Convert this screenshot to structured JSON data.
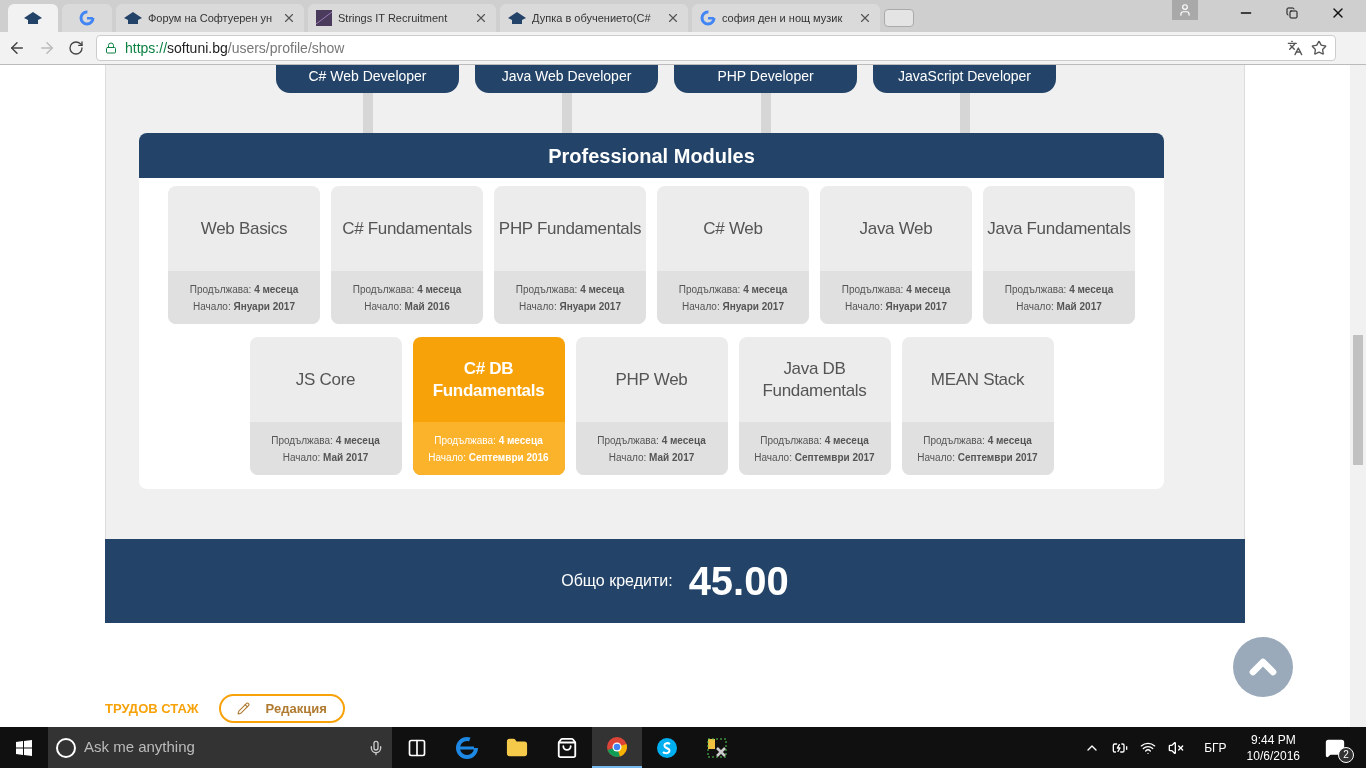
{
  "browser": {
    "tabs": [
      {
        "kind": "hat",
        "pinned": true,
        "selected": true
      },
      {
        "kind": "google",
        "pinned": true,
        "selected": false
      },
      {
        "kind": "hat",
        "pinned": false,
        "selected": false,
        "title": "Форум на Софтуерен ун"
      },
      {
        "kind": "image",
        "pinned": false,
        "selected": false,
        "title": "Strings IT Recruitment"
      },
      {
        "kind": "hat",
        "pinned": false,
        "selected": false,
        "title": "Дупка в обучението(C#"
      },
      {
        "kind": "google",
        "pinned": false,
        "selected": false,
        "title": "софия ден и нощ музик"
      }
    ],
    "address": {
      "scheme": "https://",
      "host": "softuni.bg",
      "path": "/users/profile/show"
    }
  },
  "tracks": [
    "C# Web Developer",
    "Java Web Developer",
    "PHP Developer",
    "JavaScript Developer"
  ],
  "modules_panel": {
    "title": "Professional Modules",
    "rows": [
      [
        {
          "title": "Web Basics",
          "duration": "Продължава: **4 месеца**",
          "start": "Начало: **Януари 2017**",
          "selected": false
        },
        {
          "title": "C# Fundamentals",
          "duration": "Продължава: **4 месеца**",
          "start": "Начало: **Май 2016**",
          "selected": false
        },
        {
          "title": "PHP Fundamentals",
          "duration": "Продължава: **4 месеца**",
          "start": "Начало: **Януари 2017**",
          "selected": false
        },
        {
          "title": "C# Web",
          "duration": "Продължава: **4 месеца**",
          "start": "Начало: **Януари 2017**",
          "selected": false
        },
        {
          "title": "Java Web",
          "duration": "Продължава: **4 месеца**",
          "start": "Начало: **Януари 2017**",
          "selected": false
        },
        {
          "title": "Java Fundamentals",
          "duration": "Продължава: **4 месеца**",
          "start": "Начало: **Май 2017**",
          "selected": false
        }
      ],
      [
        {
          "title": "JS Core",
          "duration": "Продължава: **4 месеца**",
          "start": "Начало: **Май 2017**",
          "selected": false
        },
        {
          "title": "C# DB Fundamentals",
          "duration": "Продължава: **4 месеца**",
          "start": "Начало: **Септември 2016**",
          "selected": true
        },
        {
          "title": "PHP Web",
          "duration": "Продължава: **4 месеца**",
          "start": "Начало: **Май 2017**",
          "selected": false
        },
        {
          "title": "Java DB Fundamentals",
          "duration": "Продължава: **4 месеца**",
          "start": "Начало: **Септември 2017**",
          "selected": false
        },
        {
          "title": "MEAN Stack",
          "duration": "Продължава: **4 месеца**",
          "start": "Начало: **Септември 2017**",
          "selected": false
        }
      ]
    ]
  },
  "credits": {
    "label": "Общо кредити:",
    "value": "45.00"
  },
  "work_experience": {
    "heading": "ТРУДОВ СТАЖ",
    "edit_button": "Редакция"
  },
  "taskbar": {
    "search_placeholder": "Ask me anything",
    "apps": [
      {
        "kind": "taskview",
        "active": false
      },
      {
        "kind": "edge",
        "active": false
      },
      {
        "kind": "explorer",
        "active": false
      },
      {
        "kind": "store",
        "active": false
      },
      {
        "kind": "chrome",
        "active": true
      },
      {
        "kind": "skype",
        "active": false
      },
      {
        "kind": "tool",
        "active": false
      }
    ],
    "language": "БГР",
    "time": "9:44 PM",
    "date": "10/6/2016",
    "notifications": "2"
  }
}
